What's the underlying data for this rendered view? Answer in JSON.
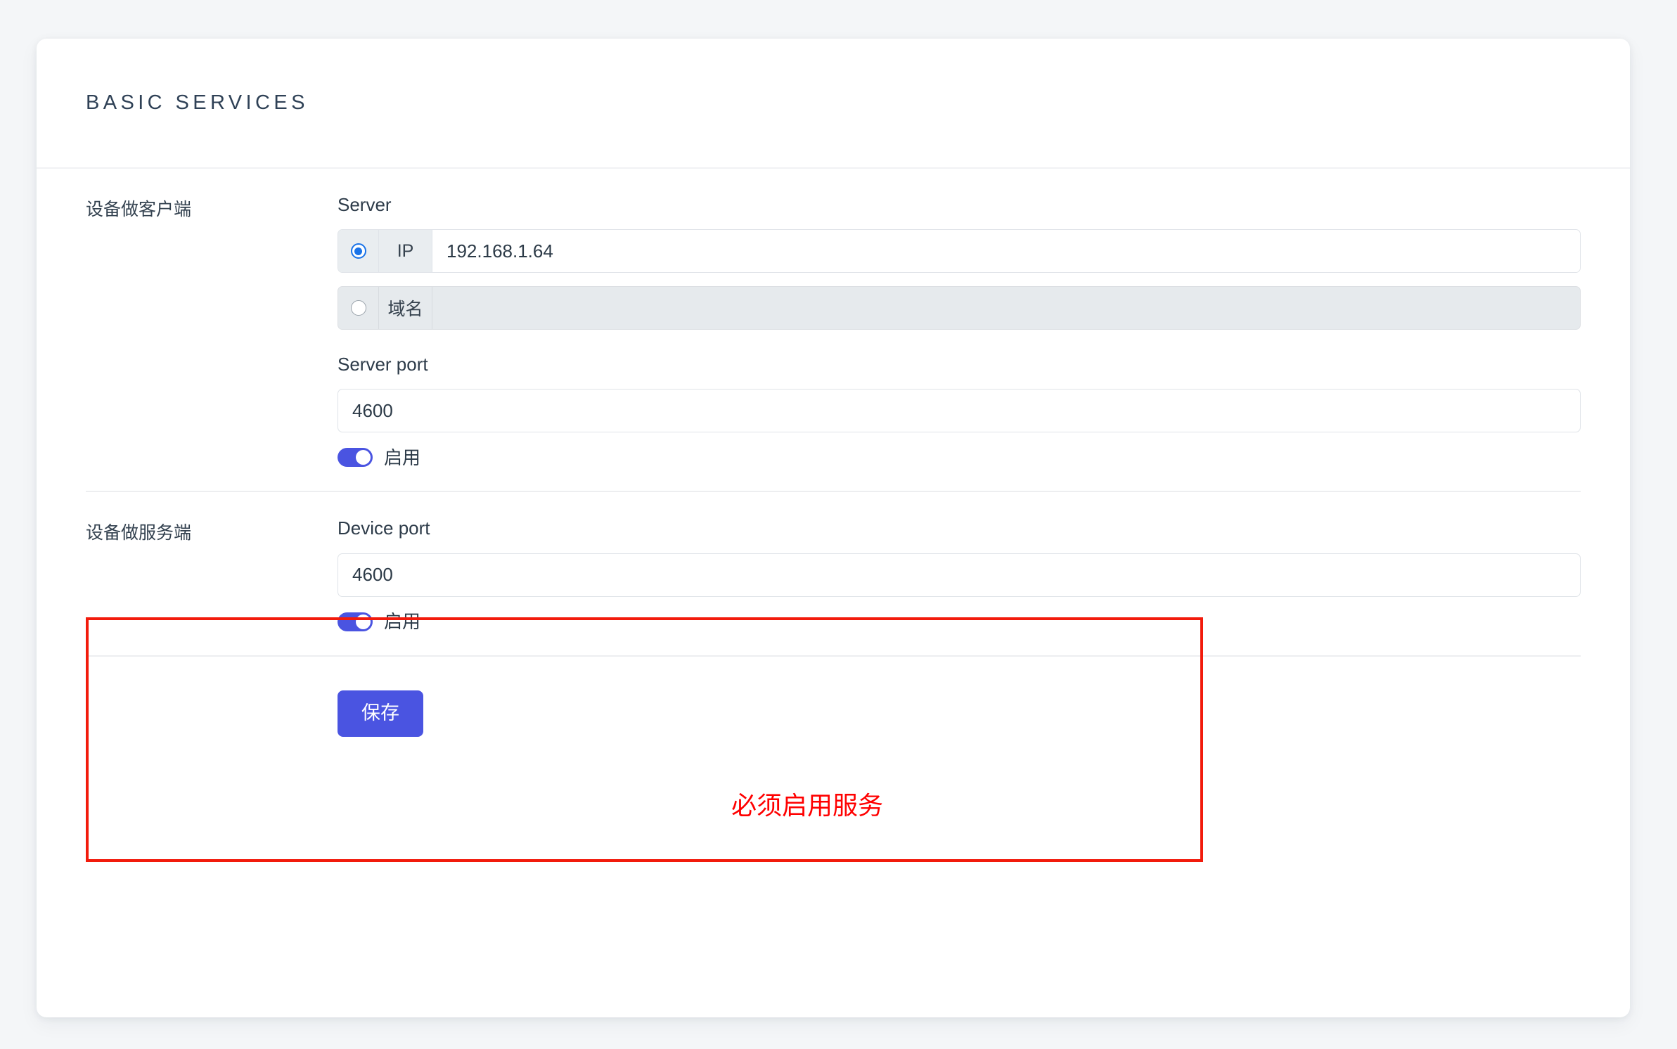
{
  "card": {
    "title": "BASIC SERVICES"
  },
  "client_section": {
    "row_label": "设备做客户端",
    "server_label": "Server",
    "ip": {
      "prefix": "IP",
      "value": "192.168.1.64",
      "selected": true
    },
    "domain": {
      "prefix": "域名",
      "value": "",
      "selected": false
    },
    "server_port_label": "Server port",
    "server_port_value": "4600",
    "toggle_label": "启用",
    "toggle_on": true
  },
  "server_section": {
    "row_label": "设备做服务端",
    "device_port_label": "Device port",
    "device_port_value": "4600",
    "toggle_label": "启用",
    "toggle_on": true,
    "annotation_text": "必须启用服务"
  },
  "footer": {
    "save_label": "保存"
  },
  "colors": {
    "accent": "#4a54e1",
    "radio_blue": "#1a73e8",
    "annotation_red": "#ff0000",
    "annotation_box": "#f21b0c",
    "page_background": "#f4f6f8",
    "title_text": "#2f4156"
  }
}
